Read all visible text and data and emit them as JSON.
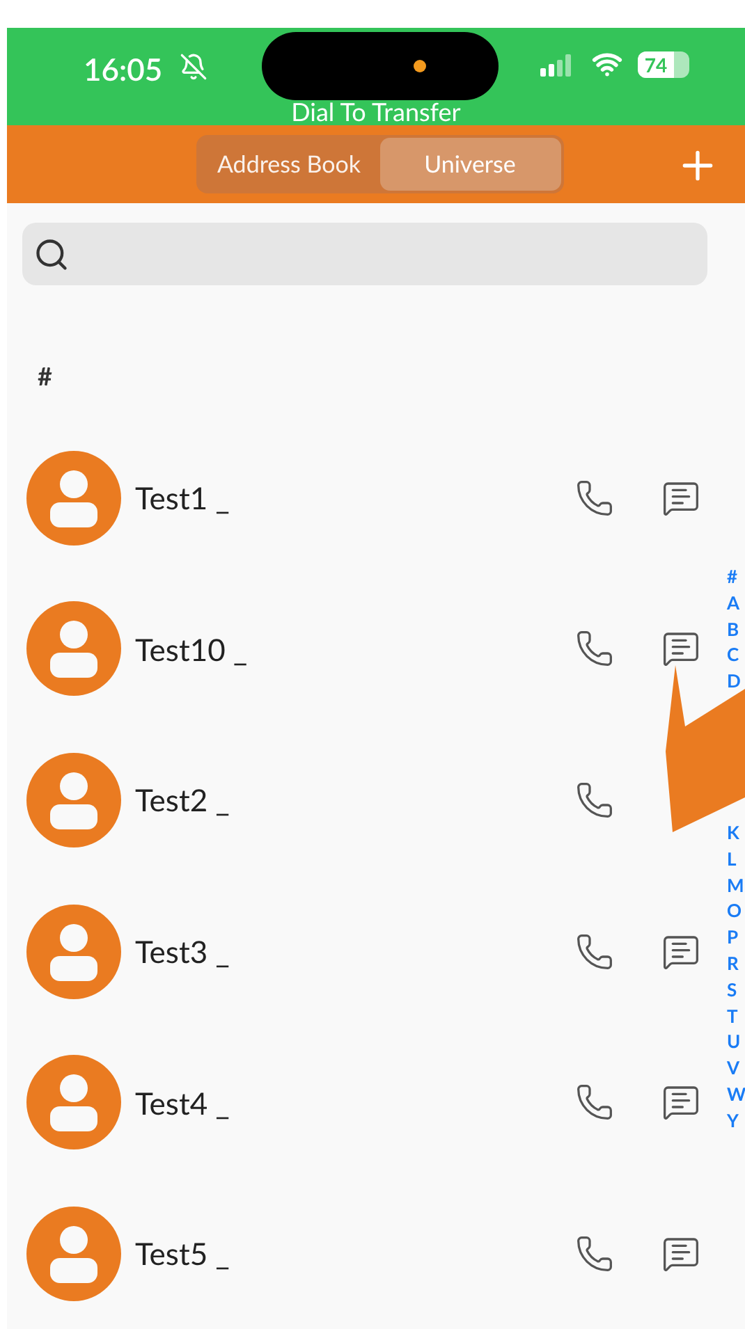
{
  "status_bar": {
    "time": "16:05",
    "battery": "74"
  },
  "header": {
    "title": "Dial To Transfer"
  },
  "segments": [
    {
      "label": "Address Book",
      "selected": false
    },
    {
      "label": "Universe",
      "selected": true
    }
  ],
  "section": {
    "header": "#"
  },
  "contacts": [
    {
      "name": "Test1 _",
      "message_icon": true
    },
    {
      "name": "Test10 _",
      "message_icon": true
    },
    {
      "name": "Test2 _",
      "message_icon": false
    },
    {
      "name": "Test3 _",
      "message_icon": true
    },
    {
      "name": "Test4 _",
      "message_icon": true
    },
    {
      "name": "Test5 _",
      "message_icon": true
    }
  ],
  "index_top": [
    "#",
    "A",
    "B",
    "C",
    "D"
  ],
  "index_bottom": [
    "K",
    "L",
    "M",
    "O",
    "P",
    "R",
    "S",
    "T",
    "U",
    "V",
    "W",
    "Y"
  ]
}
